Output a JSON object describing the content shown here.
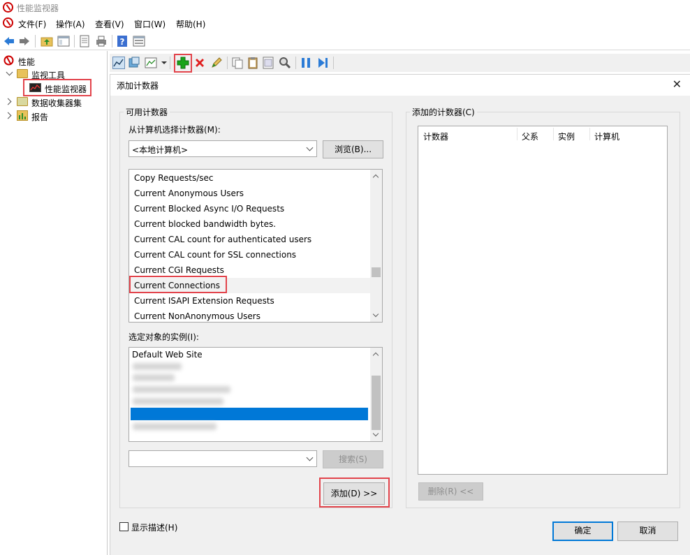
{
  "window": {
    "title": "性能监视器"
  },
  "menu": [
    "文件(F)",
    "操作(A)",
    "查看(V)",
    "窗口(W)",
    "帮助(H)"
  ],
  "tree": {
    "root": "性能",
    "items": [
      "监视工具",
      "性能监视器",
      "数据收集器集",
      "报告"
    ]
  },
  "dialog": {
    "title": "添加计数器",
    "close": "✕",
    "available_group": "可用计数器",
    "from_computer_label": "从计算机选择计数器(M):",
    "computer_value": "<本地计算机>",
    "browse_button": "浏览(B)...",
    "counters": [
      "Copy Requests/sec",
      "Current Anonymous Users",
      "Current Blocked Async I/O Requests",
      "Current blocked bandwidth bytes.",
      "Current CAL count for authenticated users",
      "Current CAL count for SSL connections",
      "Current CGI Requests",
      "Current Connections",
      "Current ISAPI Extension Requests",
      "Current NonAnonymous Users"
    ],
    "selected_counter": "Current Connections",
    "instances_label": "选定对象的实例(I):",
    "instances_first": "Default Web Site",
    "search_button": "搜索(S)",
    "add_button": "添加(D) >>",
    "added_group": "添加的计数器(C)",
    "columns": [
      "计数器",
      "父系",
      "实例",
      "计算机"
    ],
    "remove_button": "删除(R) <<",
    "show_desc": "显示描述(H)",
    "ok_button": "确定",
    "cancel_button": "取消"
  },
  "colors": {
    "highlight": "#e2434b",
    "selection": "#0078d7",
    "add_icon": "#19a319",
    "delete_icon": "#e01f1f"
  }
}
